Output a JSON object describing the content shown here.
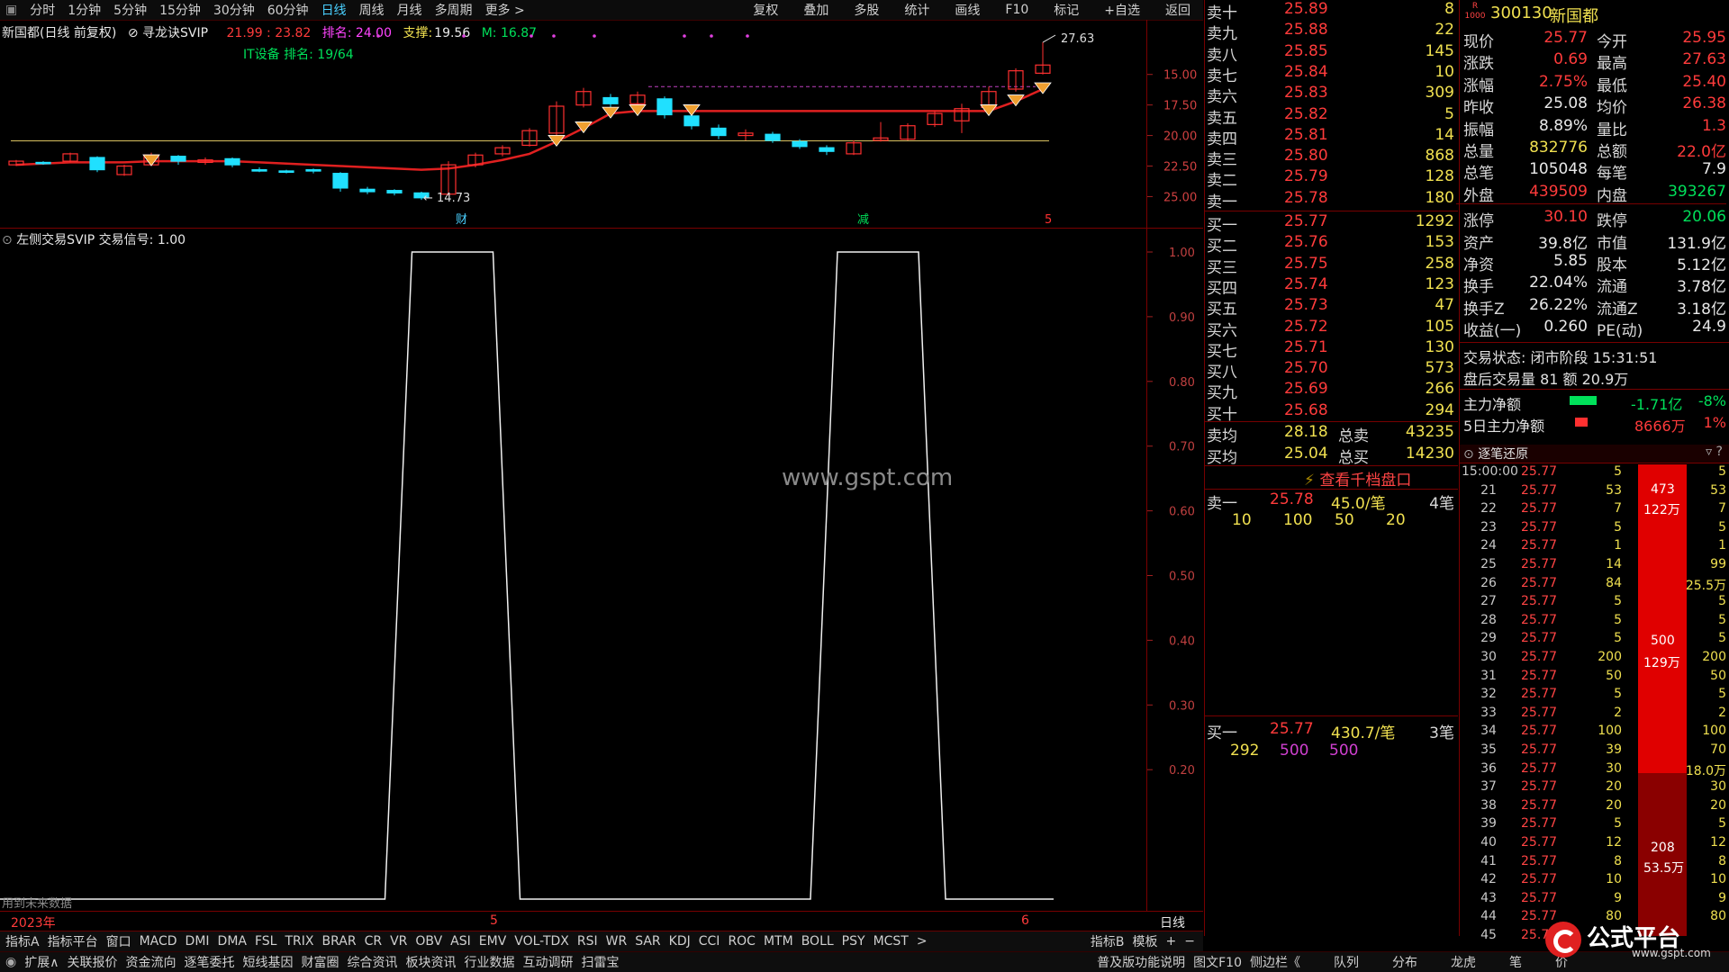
{
  "top_tabs": [
    "分时",
    "1分钟",
    "5分钟",
    "15分钟",
    "30分钟",
    "60分钟",
    "日线",
    "周线",
    "月线",
    "多周期",
    "更多 >"
  ],
  "top_active_index": 6,
  "top_right": [
    "复权",
    "叠加",
    "多股",
    "统计",
    "画线",
    "F10",
    "标记",
    "+自选",
    "返回"
  ],
  "kline_header": {
    "title": "新国都(日线 前复权)",
    "indicator": "寻龙诀SVIP",
    "range": "21.99 : 23.82",
    "rank": "排名: 24.00",
    "support_label": "支撑:",
    "support_val": "19.56",
    "m_val": "M: 16.87",
    "it_rank": "IT设备 排名: 19/64"
  },
  "price_axis": [
    "25.00",
    "22.50",
    "20.00",
    "17.50",
    "15.00"
  ],
  "price_high": "27.63",
  "price_low": "14.73",
  "markers": {
    "cai": "财",
    "jian": "减",
    "num": "5"
  },
  "indicator_header": "左侧交易SVIP  交易信号: 1.00",
  "ind_axis": [
    "1.00",
    "0.90",
    "0.80",
    "0.70",
    "0.60",
    "0.50",
    "0.40",
    "0.30",
    "0.20"
  ],
  "watermark": "www.gspt.com",
  "future_data": "用到未来数据",
  "x_year": "2023年",
  "x_month5": "5",
  "x_month6": "6",
  "period_label": "日线",
  "orderbook": {
    "asks": [
      {
        "l": "卖十",
        "p": "25.89",
        "v": "8"
      },
      {
        "l": "卖九",
        "p": "25.88",
        "v": "22"
      },
      {
        "l": "卖八",
        "p": "25.85",
        "v": "145"
      },
      {
        "l": "卖七",
        "p": "25.84",
        "v": "10"
      },
      {
        "l": "卖六",
        "p": "25.83",
        "v": "309"
      },
      {
        "l": "卖五",
        "p": "25.82",
        "v": "5"
      },
      {
        "l": "卖四",
        "p": "25.81",
        "v": "14"
      },
      {
        "l": "卖三",
        "p": "25.80",
        "v": "868"
      },
      {
        "l": "卖二",
        "p": "25.79",
        "v": "128"
      },
      {
        "l": "卖一",
        "p": "25.78",
        "v": "180"
      }
    ],
    "bids": [
      {
        "l": "买一",
        "p": "25.77",
        "v": "1292"
      },
      {
        "l": "买二",
        "p": "25.76",
        "v": "153"
      },
      {
        "l": "买三",
        "p": "25.75",
        "v": "258"
      },
      {
        "l": "买四",
        "p": "25.74",
        "v": "123"
      },
      {
        "l": "买五",
        "p": "25.73",
        "v": "47"
      },
      {
        "l": "买六",
        "p": "25.72",
        "v": "105"
      },
      {
        "l": "买七",
        "p": "25.71",
        "v": "130"
      },
      {
        "l": "买八",
        "p": "25.70",
        "v": "573"
      },
      {
        "l": "买九",
        "p": "25.69",
        "v": "266"
      },
      {
        "l": "买十",
        "p": "25.68",
        "v": "294"
      }
    ],
    "avg_sell_label": "卖均",
    "avg_sell": "28.18",
    "total_sell_label": "总卖",
    "total_sell": "43235",
    "avg_buy_label": "买均",
    "avg_buy": "25.04",
    "total_buy_label": "总买",
    "total_buy": "14230",
    "view_thousand": "查看千档盘口",
    "sell1_label": "卖一",
    "sell1_price": "25.78",
    "sell1_avg": "45.0/笔",
    "sell1_cnt": "4笔",
    "sell1_queue": [
      "10",
      "100",
      "50",
      "20"
    ],
    "buy1_label": "买一",
    "buy1_price": "25.77",
    "buy1_avg": "430.7/笔",
    "buy1_cnt": "3笔",
    "buy1_queue": [
      "292",
      "500",
      "500"
    ]
  },
  "quote": {
    "code": "300130",
    "name": "新国都",
    "r_label": "R",
    "r_num": "1000",
    "rows": [
      {
        "k1": "现价",
        "v1": "25.77",
        "c1": "red",
        "k2": "今开",
        "v2": "25.95",
        "c2": "red"
      },
      {
        "k1": "涨跌",
        "v1": "0.69",
        "c1": "red",
        "k2": "最高",
        "v2": "27.63",
        "c2": "red"
      },
      {
        "k1": "涨幅",
        "v1": "2.75%",
        "c1": "red",
        "k2": "最低",
        "v2": "25.40",
        "c2": "red"
      },
      {
        "k1": "昨收",
        "v1": "25.08",
        "c1": "white",
        "k2": "均价",
        "v2": "26.38",
        "c2": "red"
      },
      {
        "k1": "振幅",
        "v1": "8.89%",
        "c1": "white",
        "k2": "量比",
        "v2": "1.3",
        "c2": "red"
      },
      {
        "k1": "总量",
        "v1": "832776",
        "c1": "yellow",
        "k2": "总额",
        "v2": "22.0亿",
        "c2": "red"
      },
      {
        "k1": "总笔",
        "v1": "105048",
        "c1": "white",
        "k2": "每笔",
        "v2": "7.9",
        "c2": "white"
      },
      {
        "k1": "外盘",
        "v1": "439509",
        "c1": "red",
        "k2": "内盘",
        "v2": "393267",
        "c2": "green"
      },
      {
        "k1": "涨停",
        "v1": "30.10",
        "c1": "red",
        "k2": "跌停",
        "v2": "20.06",
        "c2": "green"
      },
      {
        "k1": "资产",
        "v1": "39.8亿",
        "c1": "white",
        "k2": "市值",
        "v2": "131.9亿",
        "c2": "white"
      },
      {
        "k1": "净资",
        "v1": "5.85",
        "c1": "white",
        "k2": "股本",
        "v2": "5.12亿",
        "c2": "white"
      },
      {
        "k1": "换手",
        "v1": "22.04%",
        "c1": "white",
        "k2": "流通",
        "v2": "3.78亿",
        "c2": "white"
      },
      {
        "k1": "换手Z",
        "v1": "26.22%",
        "c1": "white",
        "k2": "流通Z",
        "v2": "3.18亿",
        "c2": "white"
      },
      {
        "k1": "收益(一)",
        "v1": "0.260",
        "c1": "white",
        "k2": "PE(动)",
        "v2": "24.9",
        "c2": "white"
      }
    ],
    "trade_status": "交易状态: 闭市阶段 15:31:51",
    "after_hours": "盘后交易量 81 额 20.9万",
    "main_net_label": "主力净额",
    "main_net": "-1.71亿",
    "main_net_pct": "-8%",
    "five_day_label": "5日主力净额",
    "five_day": "8666万",
    "five_day_pct": "1%",
    "tick_title": "逐笔还原"
  },
  "ticks": {
    "rows": [
      {
        "t": "15:00:00",
        "p": "25.77",
        "v": "5",
        "r": "5"
      },
      {
        "t": "21",
        "p": "25.77",
        "v": "53",
        "r": "53"
      },
      {
        "t": "22",
        "p": "25.77",
        "v": "7",
        "r": "7"
      },
      {
        "t": "23",
        "p": "25.77",
        "v": "5",
        "r": "5"
      },
      {
        "t": "24",
        "p": "25.77",
        "v": "1",
        "r": "1"
      },
      {
        "t": "25",
        "p": "25.77",
        "v": "14",
        "r": "99"
      },
      {
        "t": "26",
        "p": "25.77",
        "v": "84",
        "r": "25.5万"
      },
      {
        "t": "27",
        "p": "25.77",
        "v": "5",
        "r": "5"
      },
      {
        "t": "28",
        "p": "25.77",
        "v": "5",
        "r": "5"
      },
      {
        "t": "29",
        "p": "25.77",
        "v": "5",
        "r": "5"
      },
      {
        "t": "30",
        "p": "25.77",
        "v": "200",
        "r": "200"
      },
      {
        "t": "31",
        "p": "25.77",
        "v": "50",
        "r": "50"
      },
      {
        "t": "32",
        "p": "25.77",
        "v": "5",
        "r": "5"
      },
      {
        "t": "33",
        "p": "25.77",
        "v": "2",
        "r": "2"
      },
      {
        "t": "34",
        "p": "25.77",
        "v": "100",
        "r": "100"
      },
      {
        "t": "35",
        "p": "25.77",
        "v": "39",
        "r": "70"
      },
      {
        "t": "36",
        "p": "25.77",
        "v": "30",
        "r": "18.0万"
      },
      {
        "t": "37",
        "p": "25.77",
        "v": "20",
        "r": "30"
      },
      {
        "t": "38",
        "p": "25.77",
        "v": "20",
        "r": "20"
      },
      {
        "t": "39",
        "p": "25.77",
        "v": "5",
        "r": "5"
      },
      {
        "t": "40",
        "p": "25.77",
        "v": "12",
        "r": "12"
      },
      {
        "t": "41",
        "p": "25.77",
        "v": "8",
        "r": "8"
      },
      {
        "t": "42",
        "p": "25.77",
        "v": "10",
        "r": "10"
      },
      {
        "t": "43",
        "p": "25.77",
        "v": "9",
        "r": "9"
      },
      {
        "t": "44",
        "p": "25.77",
        "v": "80",
        "r": "80"
      },
      {
        "t": "45",
        "p": "25.77",
        "v": "",
        "r": ""
      }
    ],
    "blocks": [
      {
        "a": "473",
        "b": "122万"
      },
      {
        "a": "500",
        "b": "129万"
      },
      {
        "a": "208",
        "b": "53.5万"
      }
    ]
  },
  "indicator_bar": [
    "指标A",
    "指标平台",
    "窗口",
    "MACD",
    "DMI",
    "DMA",
    "FSL",
    "TRIX",
    "BRAR",
    "CR",
    "VR",
    "OBV",
    "ASI",
    "EMV",
    "VOL-TDX",
    "RSI",
    "WR",
    "SAR",
    "KDJ",
    "CCI",
    "ROC",
    "MTM",
    "BOLL",
    "PSY",
    "MCST",
    ">"
  ],
  "indicator_bar_right": [
    "指标B",
    "模板",
    "+",
    "−"
  ],
  "status_bar": [
    "扩展∧",
    "关联报价",
    "资金流向",
    "逐笔委托",
    "短线基因",
    "财富圈",
    "综合资讯",
    "板块资讯",
    "行业数据",
    "互动调研",
    "扫雷宝"
  ],
  "status_right": [
    "普及版功能说明",
    "图文F10",
    "侧边栏《",
    "队列",
    "分布",
    "龙虎",
    "笔",
    "价"
  ],
  "logo": {
    "brand": "公式平台",
    "url": "www.gspt.com"
  },
  "colors": {
    "up": "#ff3b3b",
    "down": "#00e0ff",
    "bg": "#000000",
    "accent": "#4ad0ff"
  },
  "chart_data": [
    {
      "type": "candlestick",
      "title": "新国都(日线 前复权)",
      "ylim": [
        14,
        28
      ],
      "ticks": [
        15,
        17.5,
        20,
        22.5,
        25
      ],
      "series": [
        {
          "name": "K",
          "ohlc": [
            [
              17.6,
              18.0,
              17.5,
              17.9
            ],
            [
              17.8,
              17.9,
              17.6,
              17.7
            ],
            [
              17.9,
              18.6,
              17.8,
              18.5
            ],
            [
              18.2,
              18.3,
              17.0,
              17.2
            ],
            [
              16.8,
              17.6,
              16.7,
              17.5
            ],
            [
              17.6,
              18.6,
              17.5,
              18.4
            ],
            [
              18.3,
              18.4,
              17.6,
              17.9
            ],
            [
              17.8,
              18.2,
              17.6,
              18.0
            ],
            [
              18.1,
              18.2,
              17.4,
              17.6
            ],
            [
              17.2,
              17.4,
              17.0,
              17.1
            ],
            [
              17.1,
              17.2,
              16.9,
              17.0
            ],
            [
              17.2,
              17.3,
              16.9,
              17.1
            ],
            [
              16.9,
              17.0,
              15.4,
              15.7
            ],
            [
              15.6,
              15.8,
              15.2,
              15.4
            ],
            [
              15.5,
              15.6,
              15.1,
              15.3
            ],
            [
              15.3,
              15.4,
              14.73,
              14.9
            ],
            [
              15.2,
              17.9,
              15.1,
              17.6
            ],
            [
              17.6,
              18.6,
              17.4,
              18.4
            ],
            [
              18.5,
              19.2,
              18.3,
              19.0
            ],
            [
              19.2,
              20.6,
              19.1,
              20.4
            ],
            [
              20.2,
              22.8,
              20.0,
              22.4
            ],
            [
              22.5,
              23.9,
              22.3,
              23.6
            ],
            [
              23.1,
              23.4,
              22.2,
              22.6
            ],
            [
              22.6,
              23.6,
              22.4,
              23.3
            ],
            [
              23.0,
              23.2,
              21.4,
              21.7
            ],
            [
              21.6,
              21.8,
              20.5,
              20.8
            ],
            [
              20.6,
              20.9,
              19.7,
              20.0
            ],
            [
              20.0,
              20.5,
              19.6,
              20.2
            ],
            [
              20.1,
              20.3,
              19.4,
              19.6
            ],
            [
              19.5,
              19.7,
              18.9,
              19.1
            ],
            [
              19.0,
              19.2,
              18.4,
              18.7
            ],
            [
              18.5,
              19.6,
              18.4,
              19.4
            ],
            [
              19.6,
              21.1,
              19.5,
              19.8
            ],
            [
              19.7,
              21.0,
              19.6,
              20.8
            ],
            [
              20.9,
              22.0,
              20.7,
              21.8
            ],
            [
              21.2,
              22.6,
              20.2,
              22.2
            ],
            [
              22.3,
              24.0,
              22.1,
              23.6
            ],
            [
              23.8,
              25.5,
              23.6,
              25.3
            ],
            [
              25.1,
              27.63,
              25.0,
              25.77
            ]
          ]
        },
        {
          "name": "line",
          "values": [
            17.6,
            17.7,
            17.8,
            17.8,
            17.8,
            17.9,
            17.9,
            17.9,
            17.9,
            17.8,
            17.7,
            17.6,
            17.5,
            17.4,
            17.3,
            17.2,
            17.3,
            17.6,
            18.0,
            18.5,
            19.5,
            20.6,
            21.8,
            22.0,
            22.0,
            22.0,
            22.0,
            22.0,
            22.0,
            22.0,
            22.0,
            22.0,
            22.0,
            22.0,
            22.0,
            22.0,
            22.0,
            22.8,
            23.8
          ]
        },
        {
          "name": "support",
          "values": [
            19.56
          ]
        },
        {
          "name": "dash",
          "values": [
            24.0
          ]
        }
      ]
    },
    {
      "type": "line",
      "title": "左侧交易SVIP",
      "ylim": [
        0.1,
        1.0
      ],
      "series": [
        {
          "name": "交易信号",
          "x": [
            0,
            0.285,
            0.305,
            0.365,
            0.385,
            0.6,
            0.62,
            0.68,
            0.7,
            0.78
          ],
          "values": [
            0,
            0,
            1,
            1,
            0,
            0,
            1,
            1,
            0,
            0
          ]
        }
      ]
    }
  ]
}
